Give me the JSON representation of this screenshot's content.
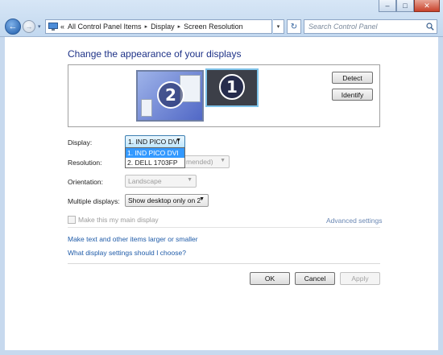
{
  "window_controls": {
    "minimize": "–",
    "maximize": "□",
    "close": "✕"
  },
  "nav": {
    "back": "←",
    "forward": "→",
    "dropdown": "▾"
  },
  "address": {
    "overflow": "«",
    "crumbs": [
      "All Control Panel Items",
      "Display",
      "Screen Resolution"
    ],
    "separator": "▸",
    "dropdown": "▾",
    "refresh": "↻"
  },
  "search": {
    "placeholder": "Search Control Panel"
  },
  "page": {
    "title": "Change the appearance of your displays"
  },
  "monitors": [
    {
      "number": "1",
      "name": "1"
    },
    {
      "number": "2",
      "name": "2"
    }
  ],
  "buttons": {
    "detect": "Detect",
    "identify": "Identify",
    "ok": "OK",
    "cancel": "Cancel",
    "apply": "Apply"
  },
  "fields": {
    "display": {
      "label": "Display:",
      "value": "1. IND PICO DVI",
      "options": [
        "1. IND PICO DVI",
        "2. DELL 1703FP"
      ]
    },
    "resolution": {
      "label": "Resolution:",
      "value_visible": "mended)"
    },
    "orientation": {
      "label": "Orientation:",
      "value": "Landscape"
    },
    "multiple": {
      "label": "Multiple displays:",
      "value": "Show desktop only on 2"
    }
  },
  "main_display_checkbox": "Make this my main display",
  "advanced_settings": "Advanced settings",
  "links": {
    "text_size": "Make text and other items larger or smaller",
    "which_settings": "What display settings should I choose?"
  },
  "colors": {
    "accent": "#1e3287",
    "link": "#1f5ba8",
    "selection": "#3399ff"
  },
  "icons": {
    "control-panel": "control-panel-icon",
    "search": "search-icon",
    "refresh": "refresh-icon"
  }
}
